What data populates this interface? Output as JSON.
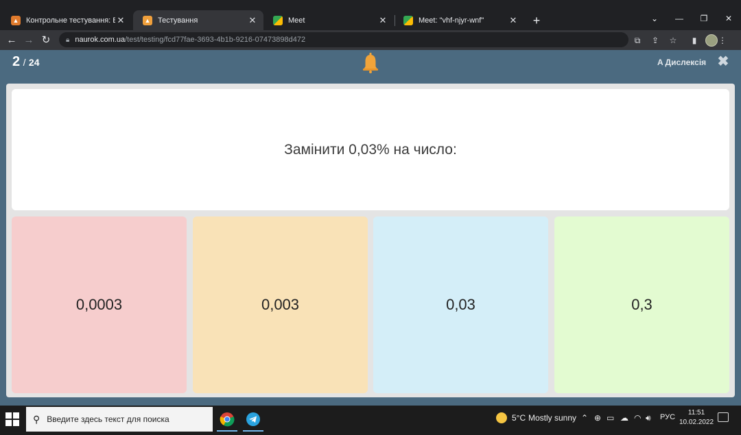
{
  "browser": {
    "tabs": [
      {
        "title": "Контрольне тестування: Відноше",
        "active": false
      },
      {
        "title": "Тестування",
        "active": true
      },
      {
        "title": "Meet",
        "active": false
      },
      {
        "title": "Meet: \"vhf-njyr-wnf\"",
        "active": false
      }
    ],
    "url_host": "naurok.com.ua",
    "url_path": "/test/testing/fcd77fae-3693-4b1b-9216-07473898d472"
  },
  "quiz": {
    "current": "2",
    "separator": "/",
    "total": "24",
    "dyslexia_label": "A Дислексія",
    "question": "Замінити 0,03% на число:",
    "answers": [
      {
        "text": "0,0003",
        "color": "#f6cdcd"
      },
      {
        "text": "0,003",
        "color": "#f9e2b7"
      },
      {
        "text": "0,03",
        "color": "#d4eef8"
      },
      {
        "text": "0,3",
        "color": "#e3fbd1"
      }
    ]
  },
  "taskbar": {
    "search_placeholder": "Введите здесь текст для поиска",
    "weather_temp": "5°C",
    "weather_desc": "Mostly sunny",
    "language": "РУС",
    "time": "11:51",
    "date": "10.02.2022"
  }
}
